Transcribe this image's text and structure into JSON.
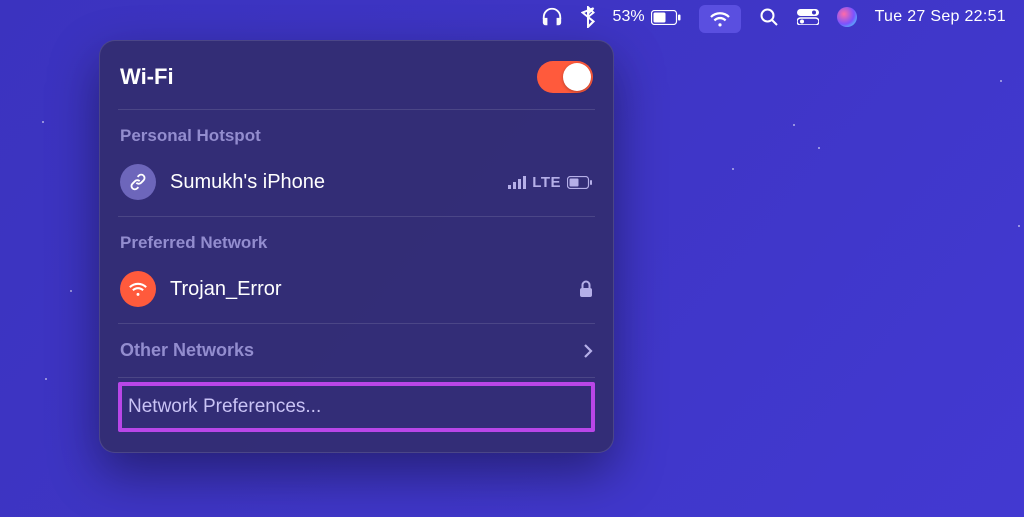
{
  "menubar": {
    "battery_percent": "53%",
    "datetime": "Tue 27 Sep  22:51"
  },
  "dropdown": {
    "title": "Wi-Fi",
    "toggle_on": true,
    "personal_hotspot": {
      "section_label": "Personal Hotspot",
      "device_name": "Sumukh's iPhone",
      "signal_label": "LTE"
    },
    "preferred_network": {
      "section_label": "Preferred Network",
      "network_name": "Trojan_Error",
      "locked": true
    },
    "other_networks": {
      "label": "Other Networks"
    },
    "preferences": {
      "label": "Network Preferences..."
    }
  }
}
